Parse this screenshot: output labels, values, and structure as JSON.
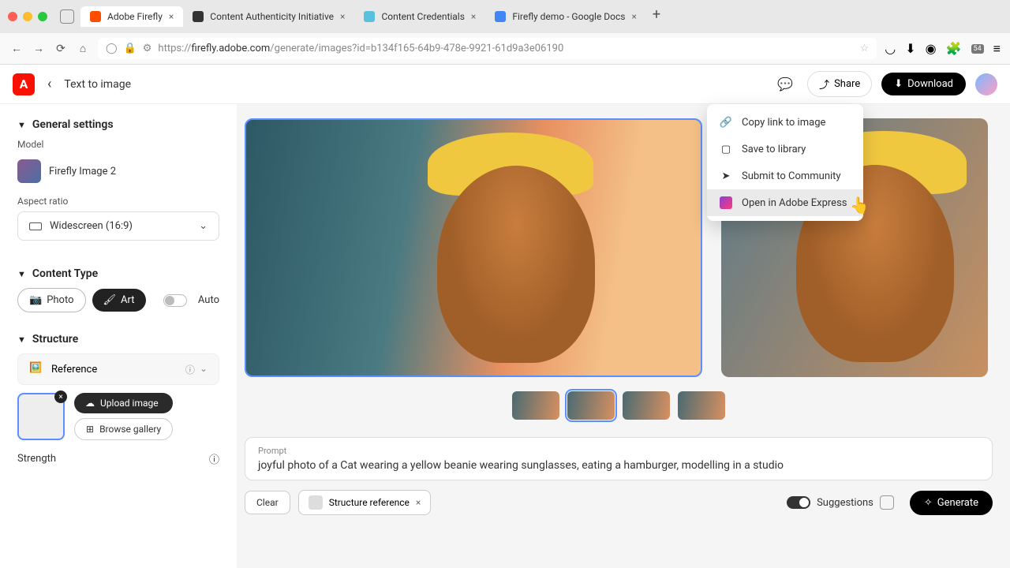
{
  "browser": {
    "tabs": [
      {
        "label": "Adobe Firefly"
      },
      {
        "label": "Content Authenticity Initiative"
      },
      {
        "label": "Content Credentials"
      },
      {
        "label": "Firefly demo - Google Docs"
      }
    ],
    "url_prefix": "https://",
    "url_domain": "firefly.adobe.com",
    "url_path": "/generate/images?id=b134f165-64b9-478e-9921-61d9a3e06190",
    "ext_badge": "54"
  },
  "header": {
    "breadcrumb": "Text to image",
    "share": "Share",
    "download": "Download"
  },
  "dropdown": {
    "items": [
      {
        "label": "Copy link to image",
        "key": "copy-link"
      },
      {
        "label": "Save to library",
        "key": "save-library"
      },
      {
        "label": "Submit to Community",
        "key": "submit-community"
      },
      {
        "label": "Open in Adobe Express",
        "key": "open-express",
        "hovered": true
      }
    ]
  },
  "sidebar": {
    "general": "General settings",
    "model_label": "Model",
    "model_name": "Firefly Image 2",
    "aspect_label": "Aspect ratio",
    "aspect_value": "Widescreen (16:9)",
    "content_type": "Content Type",
    "photo": "Photo",
    "art": "Art",
    "auto": "Auto",
    "structure": "Structure",
    "reference": "Reference",
    "upload": "Upload image",
    "browse": "Browse gallery",
    "strength": "Strength"
  },
  "prompt": {
    "label": "Prompt",
    "text": "joyful photo of a Cat wearing a yellow beanie wearing sunglasses, eating a hamburger, modelling in a studio"
  },
  "bottom": {
    "clear": "Clear",
    "chip": "Structure reference",
    "suggestions": "Suggestions",
    "generate": "Generate"
  }
}
